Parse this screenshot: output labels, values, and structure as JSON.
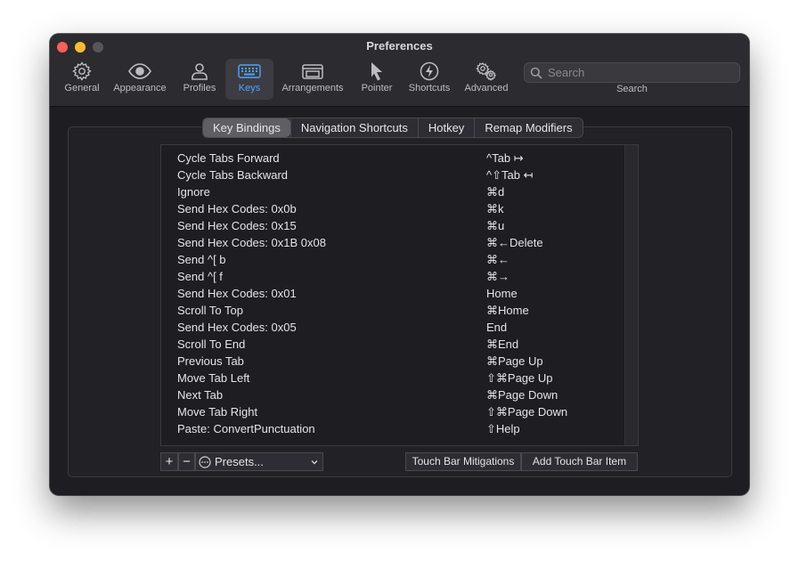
{
  "window": {
    "title": "Preferences"
  },
  "toolbar": {
    "items": [
      {
        "label": "General",
        "icon": "gear-icon"
      },
      {
        "label": "Appearance",
        "icon": "eye-icon"
      },
      {
        "label": "Profiles",
        "icon": "person-icon"
      },
      {
        "label": "Keys",
        "icon": "keyboard-icon",
        "selected": true
      },
      {
        "label": "Arrangements",
        "icon": "windows-icon"
      },
      {
        "label": "Pointer",
        "icon": "pointer-icon"
      },
      {
        "label": "Shortcuts",
        "icon": "lightning-icon"
      },
      {
        "label": "Advanced",
        "icon": "gears-icon"
      }
    ],
    "search": {
      "placeholder": "Search",
      "label": "Search"
    }
  },
  "tabs": [
    {
      "label": "Key Bindings",
      "selected": true
    },
    {
      "label": "Navigation Shortcuts"
    },
    {
      "label": "Hotkey"
    },
    {
      "label": "Remap Modifiers"
    }
  ],
  "bindings": [
    {
      "action": "Cycle Tabs Forward",
      "shortcut": "^Tab ↦"
    },
    {
      "action": "Cycle Tabs Backward",
      "shortcut": "^⇧Tab ↤"
    },
    {
      "action": "Ignore",
      "shortcut": "⌘d"
    },
    {
      "action": "Send Hex Codes: 0x0b",
      "shortcut": "⌘k"
    },
    {
      "action": "Send Hex Codes: 0x15",
      "shortcut": "⌘u"
    },
    {
      "action": "Send Hex Codes: 0x1B 0x08",
      "shortcut": "⌘←Delete"
    },
    {
      "action": "Send ^[ b",
      "shortcut": "⌘←"
    },
    {
      "action": "Send ^[ f",
      "shortcut": "⌘→"
    },
    {
      "action": "Send Hex Codes: 0x01",
      "shortcut": "Home"
    },
    {
      "action": "Scroll To Top",
      "shortcut": "⌘Home"
    },
    {
      "action": "Send Hex Codes: 0x05",
      "shortcut": "End"
    },
    {
      "action": "Scroll To End",
      "shortcut": "⌘End"
    },
    {
      "action": "Previous Tab",
      "shortcut": "⌘Page Up"
    },
    {
      "action": "Move Tab Left",
      "shortcut": "⇧⌘Page Up"
    },
    {
      "action": "Next Tab",
      "shortcut": "⌘Page Down"
    },
    {
      "action": "Move Tab Right",
      "shortcut": "⇧⌘Page Down"
    },
    {
      "action": "Paste: ConvertPunctuation",
      "shortcut": "⇧Help"
    }
  ],
  "bottom": {
    "add_label": "+",
    "remove_label": "−",
    "presets_label": "Presets...",
    "touch_bar_mitigations": "Touch Bar Mitigations",
    "add_touch_bar_item": "Add Touch Bar Item"
  },
  "colors": {
    "accent": "#4da3ff",
    "close": "#ff5f57",
    "minimize": "#febc2e",
    "maximize": "#56555a"
  }
}
